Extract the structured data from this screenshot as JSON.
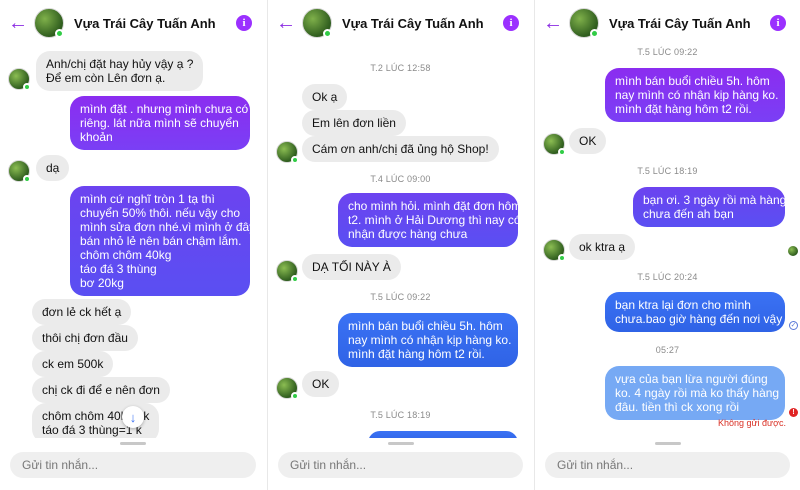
{
  "header": {
    "title": "Vựa Trái Cây Tuấn Anh",
    "back_icon": "arrow-left-icon",
    "info_icon": "info-icon",
    "accent_color": "#8a2be2"
  },
  "composer": {
    "placeholder": "Gửi tin nhắn..."
  },
  "panel1": {
    "messages": [
      {
        "from": "shop",
        "lines": [
          "Anh/chị đặt hay hủy vậy ạ ?",
          "Để em còn  Lên đơn ạ."
        ]
      },
      {
        "from": "me",
        "lines": [
          "mình đặt . nhưng mình  chưa có tk",
          "riêng. lát nữa mình sẽ chuyển",
          "khoản"
        ]
      },
      {
        "from": "shop",
        "lines": [
          "dạ"
        ]
      },
      {
        "from": "me",
        "lines": [
          "mình cứ  nghĩ  tròn  1 tạ thì",
          "chuyển 50% thôi. nếu  vậy  cho",
          "mình  sửa  đơn nhé.vì mình ở đây",
          "bán nhỏ lẻ nên bán chậm lắm.",
          "chôm chôm 40kg",
          "táo đá            3 thùng",
          "bơ                    20kg"
        ]
      },
      {
        "from": "shop",
        "lines": [
          "đơn lẻ ck hết ạ"
        ]
      },
      {
        "from": "shop",
        "lines": [
          "thôi chị đơn đầu"
        ]
      },
      {
        "from": "shop",
        "lines": [
          "ck em 500k"
        ]
      },
      {
        "from": "shop",
        "lines": [
          "chị ck đi để e nên đơn"
        ]
      },
      {
        "from": "shop",
        "lines": [
          "chôm chôm 40k    00k",
          "táo đá 3 thùng=1    k"
        ]
      }
    ]
  },
  "panel2": {
    "messages": [
      {
        "type": "time",
        "text": "T.2 LÚC 12:58"
      },
      {
        "from": "shop",
        "lines": [
          "Ok ạ"
        ]
      },
      {
        "from": "shop",
        "lines": [
          "Em lên đơn liền"
        ]
      },
      {
        "from": "shop",
        "lines": [
          "Cám ơn anh/chị đã ủng hộ Shop!"
        ]
      },
      {
        "type": "time",
        "text": "T.4 LÚC 09:00"
      },
      {
        "from": "me",
        "lines": [
          "cho mình hỏi.  mình đặt đơn hôm",
          "t2. mình ở Hải Dương thì nay có",
          "nhận được hàng chưa"
        ]
      },
      {
        "from": "shop",
        "lines": [
          "DẠ TỐI NÀY À"
        ]
      },
      {
        "type": "time",
        "text": "T.5 LÚC 09:22"
      },
      {
        "from": "me",
        "lines": [
          "mình  bán  buổi  chiều  5h. hôm",
          "nay mình  có nhận  kịp  hàng ko.",
          "mình đặt hàng hôm t2 rồi."
        ]
      },
      {
        "from": "shop",
        "lines": [
          "OK"
        ]
      },
      {
        "type": "time",
        "text": "T.5 LÚC 18:19"
      }
    ]
  },
  "panel3": {
    "messages": [
      {
        "type": "time",
        "text": "T.5 LÚC 09:22"
      },
      {
        "from": "me",
        "lines": [
          "mình  bán  buổi  chiều  5h.  hôm",
          "nay mình  có nhận  kịp  hàng ko.",
          "mình đặt hàng hôm t2 rồi."
        ]
      },
      {
        "from": "shop",
        "lines": [
          "OK"
        ]
      },
      {
        "type": "time",
        "text": "T.5 LÚC 18:19"
      },
      {
        "from": "me",
        "lines": [
          "bạn  ơi.  3 ngày  rồi mà hàng",
          "chưa đến ah bạn"
        ]
      },
      {
        "from": "shop",
        "lines": [
          "ok ktra ạ"
        ]
      },
      {
        "type": "time",
        "text": "T.5 LÚC 20:24"
      },
      {
        "from": "me",
        "lines": [
          "bạn  ktra lại  đơn cho mình",
          "chưa.bao giờ hàng đến  nơi vậy"
        ]
      },
      {
        "type": "time",
        "text": "05:27"
      },
      {
        "from": "me",
        "lines": [
          "vựa  của bạn  lừa  người  đúng",
          "ko.  4 ngày  rồi  mà ko thấy hàng",
          "đâu. tiền  thì  ck xong rồi"
        ]
      }
    ],
    "error_text": "Không gửi được."
  }
}
